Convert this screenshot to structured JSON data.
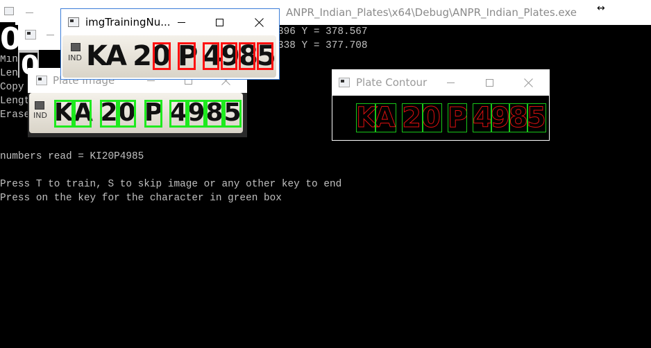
{
  "console": {
    "title": "ANPR_Indian_Plates\\x64\\Debug\\ANPR_Indian_Plates.exe",
    "resize_cursor": "↔",
    "lines": [
      "396 Y = 378.567",
      "338 Y = 377.708",
      "Min",
      "Leng",
      "Copy",
      "Lengt",
      "Erase",
      "numbers read = KI20P4985",
      "Press T to train, S to skip image or any other key to end",
      "Press on the key for the character in green box"
    ]
  },
  "training_window": {
    "title": "imgTrainingNu...",
    "plate_country": "IND",
    "characters": [
      "K",
      "A",
      "2",
      "0",
      "P",
      "4",
      "9",
      "8",
      "5"
    ]
  },
  "plate_image_window": {
    "title": "Plate Image",
    "plate_country": "IND",
    "characters": [
      "K",
      "A",
      "2",
      "0",
      "P",
      "4",
      "9",
      "8",
      "5"
    ]
  },
  "plate_contour_window": {
    "title": "Plate Contour",
    "characters": [
      "K",
      "A",
      "2",
      "0",
      "P",
      "4",
      "9",
      "8",
      "5"
    ]
  },
  "back_window_1": {
    "digit": "0"
  },
  "back_window_2": {
    "digit": "0"
  },
  "window_controls": {
    "minimize": "minimize",
    "maximize": "maximize",
    "close": "close"
  },
  "colors": {
    "console_bg": "#000000",
    "console_text": "#c0c0c0",
    "green_box": "#1eea1e",
    "red_box": "#ff1010",
    "contour_stroke": "#e01010"
  }
}
